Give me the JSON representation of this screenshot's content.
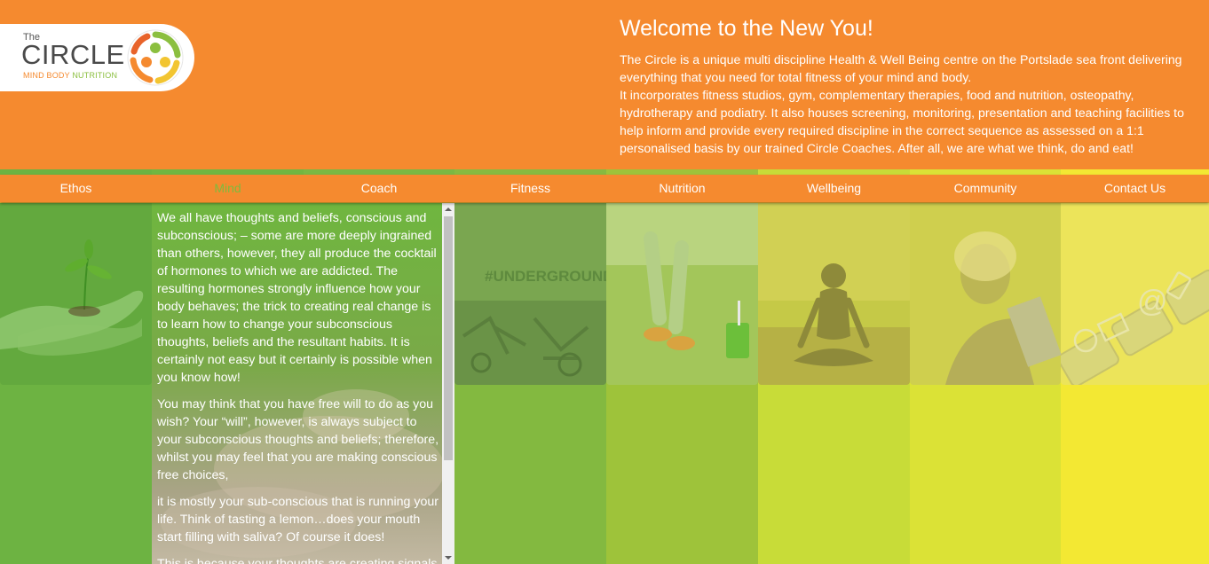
{
  "logo": {
    "the": "The",
    "circle": "CIRCLE",
    "tag_mind_body": "MIND BODY",
    "tag_nutrition": "NUTRITION"
  },
  "welcome": {
    "title": "Welcome to the New You!",
    "paragraph1": "The Circle is a unique multi discipline Health & Well Being centre on the Portslade sea front delivering everything that you need for total fitness of your mind and body.",
    "paragraph2": "It incorporates fitness studios, gym, complementary therapies, food and nutrition, osteopathy, hydrotherapy and podiatry. It also houses screening, monitoring, presentation and teaching facilities to help inform and provide every required discipline in the correct sequence as assessed on a 1:1 personalised basis by our trained Circle Coaches. After all, we are what we think, do and eat!"
  },
  "nav": {
    "items": [
      {
        "label": "Ethos",
        "color": "#6db342"
      },
      {
        "label": "Mind",
        "color": "#72b641",
        "active": true
      },
      {
        "label": "Coach",
        "color": "#7ab843"
      },
      {
        "label": "Fitness",
        "color": "#87ba40"
      },
      {
        "label": "Nutrition",
        "color": "#9ec33a"
      },
      {
        "label": "Wellbeing",
        "color": "#c8dc38"
      },
      {
        "label": "Community",
        "color": "#dbe236"
      },
      {
        "label": "Contact Us",
        "color": "#f3e833"
      }
    ]
  },
  "mind": {
    "paragraphs": [
      "We all have thoughts and beliefs, conscious and subconscious; – some are more deeply ingrained than others, however, they all produce the cocktail of hormones to which we are addicted. The resulting hormones strongly influence how your body behaves; the trick to creating real change is to learn how to change your subconscious thoughts, beliefs and the resultant habits. It is certainly not easy but it certainly is possible when you know how!",
      "You may think that you have free will to do as you wish? Your “will”, however, is always subject to your subconscious thoughts and beliefs; therefore, whilst you may feel that you are making conscious free choices,",
      "it is mostly your sub-conscious that is running your life. Think of tasting a lemon…does your mouth start filling with saliva? Of course it does!",
      "This is because your thoughts are creating signals"
    ]
  },
  "tiles": {
    "fitness_sign": "#UNDERGROUNDGYM"
  },
  "colors": {
    "orange": "#f58a2f",
    "green": "#6db342",
    "yellow": "#f3e833"
  }
}
